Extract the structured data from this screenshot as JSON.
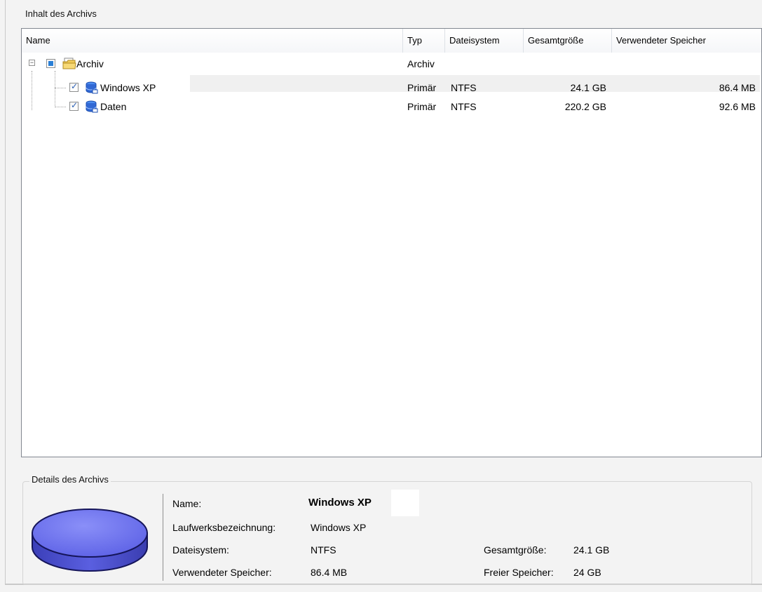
{
  "archive_contents": {
    "title": "Inhalt des Archivs",
    "columns": [
      "Name",
      "Typ",
      "Dateisystem",
      "Gesamtgröße",
      "Verwendeter Speicher"
    ],
    "root": {
      "name": "Archiv",
      "type": "Archiv",
      "icon": "folder-icon"
    },
    "rows": [
      {
        "name": "Windows XP",
        "type": "Primär",
        "filesystem": "NTFS",
        "total": "24.1 GB",
        "used": "86.4 MB",
        "icon": "partition-icon",
        "checked": true
      },
      {
        "name": "Daten",
        "type": "Primär",
        "filesystem": "NTFS",
        "total": "220.2 GB",
        "used": "92.6 MB",
        "icon": "partition-icon",
        "checked": true
      }
    ]
  },
  "details": {
    "title": "Details des Archivs",
    "name_label": "Name:",
    "name_value": "Windows XP",
    "drive_label_label": "Laufwerksbezeichnung:",
    "drive_label_value": "Windows XP",
    "filesystem_label": "Dateisystem:",
    "filesystem_value": "NTFS",
    "used_label": "Verwendeter Speicher:",
    "used_value": "86.4 MB",
    "total_label": "Gesamtgröße:",
    "total_value": "24.1 GB",
    "free_label": "Freier Speicher:",
    "free_value": "24 GB"
  },
  "colors": {
    "selection_blue": "#2a7fd6",
    "disk_blue": "#6a6ff0"
  }
}
